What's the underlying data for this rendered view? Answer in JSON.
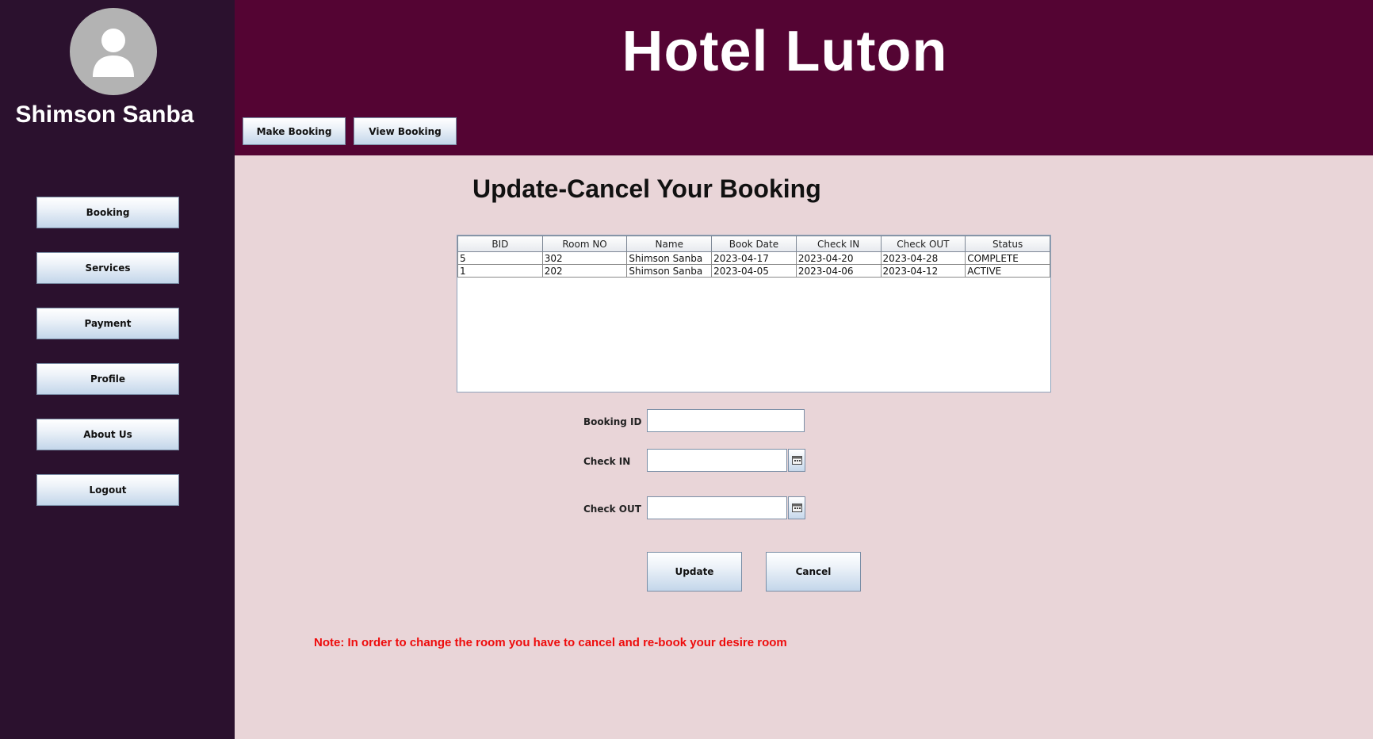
{
  "user": {
    "name": "Shimson Sanba"
  },
  "app": {
    "title": "Hotel Luton"
  },
  "sidebar": {
    "items": [
      {
        "label": "Booking"
      },
      {
        "label": "Services"
      },
      {
        "label": "Payment"
      },
      {
        "label": "Profile"
      },
      {
        "label": "About Us"
      },
      {
        "label": "Logout"
      }
    ]
  },
  "header": {
    "buttons": [
      {
        "label": "Make Booking"
      },
      {
        "label": "View Booking"
      }
    ]
  },
  "main": {
    "title": "Update-Cancel Your Booking",
    "table": {
      "columns": [
        "BID",
        "Room NO",
        "Name",
        "Book Date",
        "Check IN",
        "Check OUT",
        "Status"
      ],
      "rows": [
        [
          "5",
          "302",
          "Shimson Sanba",
          "2023-04-17",
          "2023-04-20",
          "2023-04-28",
          "COMPLETE"
        ],
        [
          "1",
          "202",
          "Shimson Sanba",
          "2023-04-05",
          "2023-04-06",
          "2023-04-12",
          "ACTIVE"
        ]
      ]
    },
    "form": {
      "booking_id_label": "Booking ID",
      "booking_id_value": "",
      "check_in_label": "Check IN",
      "check_in_value": "",
      "check_out_label": "Check OUT",
      "check_out_value": "",
      "update_label": "Update",
      "cancel_label": "Cancel"
    },
    "note": "Note: In order to change the room you have to cancel and re-book your desire room"
  },
  "colors": {
    "sidebar_bg": "#2b112e",
    "header_bg": "#540433",
    "content_bg": "#e9d5d8",
    "note_text": "#ee0c0c"
  },
  "icons": {
    "avatar": "user-silhouette-icon",
    "date_picker": "calendar-icon"
  }
}
